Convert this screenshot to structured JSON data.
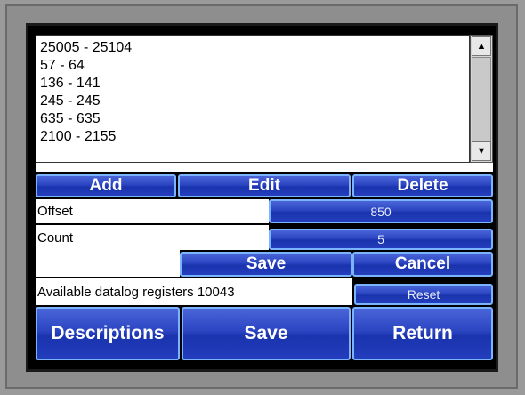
{
  "register_list": {
    "items": [
      "25005 - 25104",
      "57 - 64",
      "136 - 141",
      "245 - 245",
      "635 - 635",
      "2100 - 2155"
    ]
  },
  "scrollbar": {
    "up_glyph": "▲",
    "down_glyph": "▼"
  },
  "actions": {
    "add": "Add",
    "edit": "Edit",
    "delete": "Delete"
  },
  "offset": {
    "label": "Offset",
    "value": "850"
  },
  "count": {
    "label": "Count",
    "value": "5"
  },
  "edit_actions": {
    "save": "Save",
    "cancel": "Cancel"
  },
  "status": {
    "available_text": "Available datalog registers 10043",
    "reset_label": "Reset"
  },
  "footer": {
    "descriptions": "Descriptions",
    "save": "Save",
    "return": "Return"
  },
  "colors": {
    "button_blue": "#2b45c2",
    "button_border": "#7ab4ff",
    "screen_bg": "#000000",
    "bezel": "#8e8e8e"
  }
}
